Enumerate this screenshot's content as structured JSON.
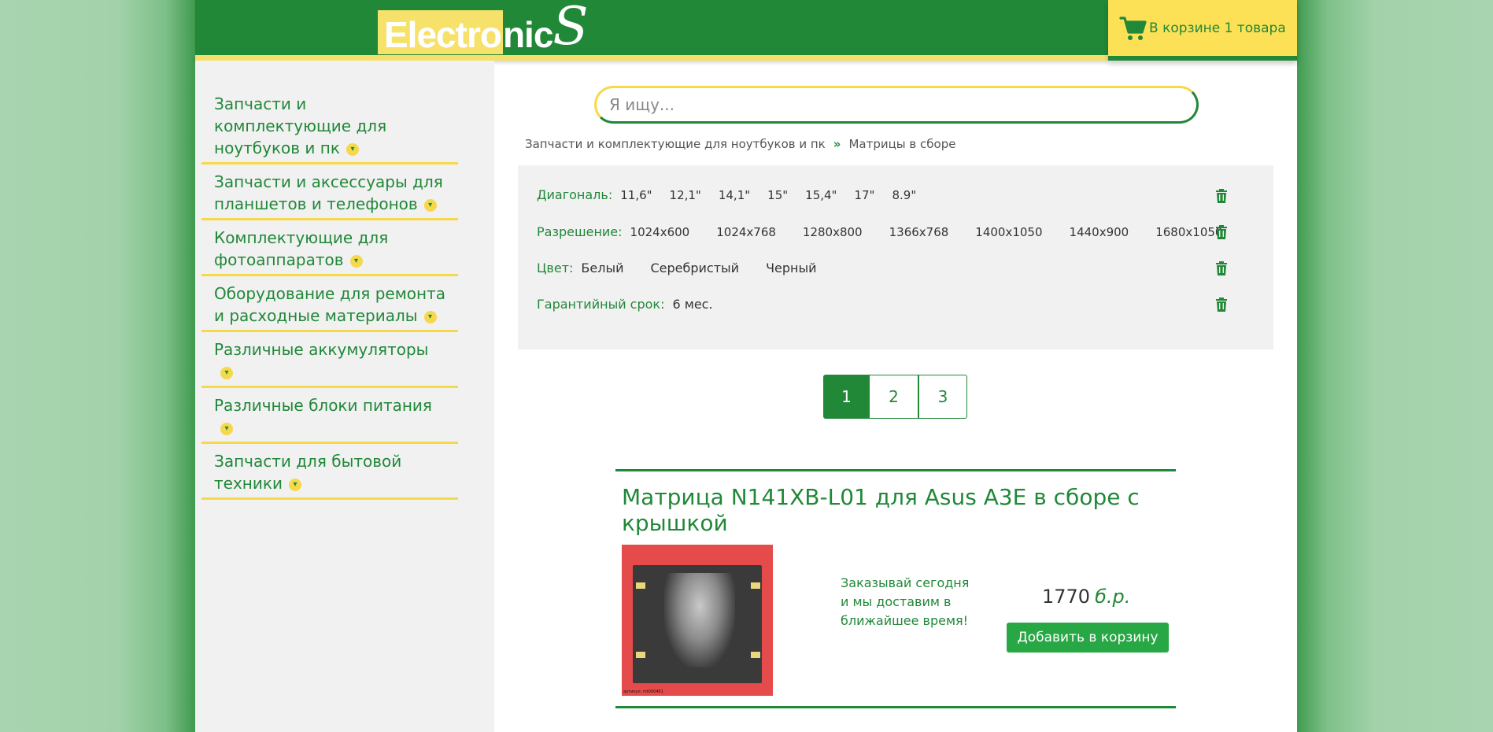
{
  "header": {
    "logo_part1": "Electro",
    "logo_part2": "nic",
    "logo_s": "S",
    "cart_text": "В корзине 1 товара"
  },
  "search": {
    "placeholder": "Я ищу..."
  },
  "sidebar": {
    "items": [
      {
        "label": "Запчасти и комплектующие для ноутбуков и пк"
      },
      {
        "label": "Запчасти и аксессуары для планшетов и телефонов"
      },
      {
        "label": "Комплектующие для фотоаппаратов"
      },
      {
        "label": "Оборудование для ремонта и расходные материалы"
      },
      {
        "label": "Различные аккумуляторы"
      },
      {
        "label": "Различные блоки питания"
      },
      {
        "label": "Запчасти для бытовой техники"
      }
    ]
  },
  "breadcrumb": {
    "parent": "Запчасти и комплектующие для ноутбуков и пк",
    "current": "Матрицы в сборе"
  },
  "filters": [
    {
      "label": "Диагональ:",
      "values": [
        "11,6\"",
        "12,1\"",
        "14,1\"",
        "15\"",
        "15,4\"",
        "17\"",
        "8.9\""
      ]
    },
    {
      "label": "Разрешение:",
      "values": [
        "1024x600",
        "1024x768",
        "1280x800",
        "1366x768",
        "1400x1050",
        "1440x900",
        "1680x1050"
      ]
    },
    {
      "label": "Цвет:",
      "values": [
        "Белый",
        "Серебристый",
        "Черный"
      ]
    },
    {
      "label": "Гарантийный срок:",
      "values": [
        "6 мес."
      ]
    }
  ],
  "pagination": {
    "pages": [
      "1",
      "2",
      "3"
    ],
    "active": "1"
  },
  "product": {
    "title": "Матрица N141XB-L01 для Asus A3E в сборе с крышкой",
    "info": "Заказывай сегодня и мы доставим в ближайшее время!",
    "price": "1770",
    "currency": "б.р.",
    "add_label": "Добавить в корзину",
    "image_code": "артикул: mt000461"
  },
  "colors": {
    "brand_green": "#218838",
    "accent_yellow": "#f6d94a",
    "button_green": "#28a745"
  }
}
